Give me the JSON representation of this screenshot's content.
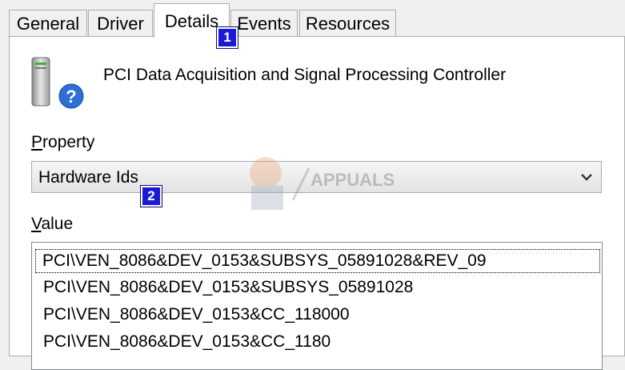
{
  "tabs": [
    "General",
    "Driver",
    "Details",
    "Events",
    "Resources"
  ],
  "active_tab": "Details",
  "device": {
    "name": "PCI Data Acquisition and Signal Processing Controller",
    "icon": "unknown-device-icon"
  },
  "property": {
    "label_first": "P",
    "label_rest": "roperty",
    "selected": "Hardware Ids"
  },
  "value": {
    "label_first": "V",
    "label_rest": "alue",
    "items": [
      "PCI\\VEN_8086&DEV_0153&SUBSYS_05891028&REV_09",
      "PCI\\VEN_8086&DEV_0153&SUBSYS_05891028",
      "PCI\\VEN_8086&DEV_0153&CC_118000",
      "PCI\\VEN_8086&DEV_0153&CC_1180"
    ]
  },
  "annotations": {
    "step1": "1",
    "step2": "2"
  },
  "watermark": {
    "text": "APPUALS"
  },
  "colors": {
    "badge": "#1a1ad6",
    "panel": "#ffffff",
    "chrome": "#f0f0f0"
  }
}
